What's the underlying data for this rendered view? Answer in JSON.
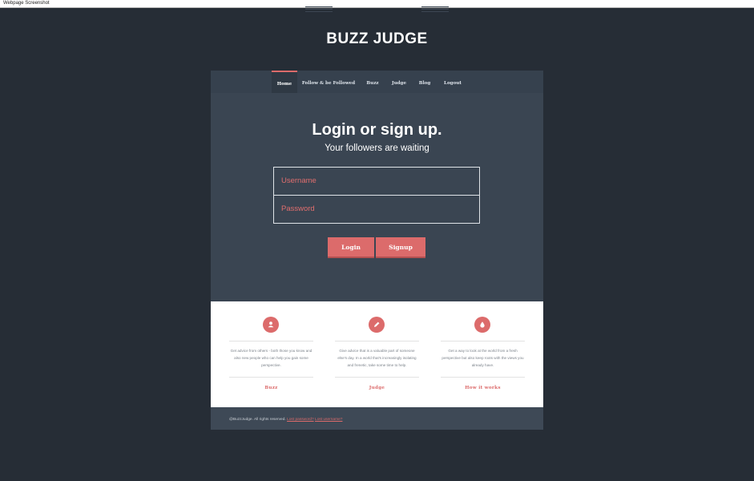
{
  "window": {
    "title": "Webpage Screenshot"
  },
  "site": {
    "logo": "BUZZ JUDGE"
  },
  "nav": {
    "items": [
      {
        "label": "Home",
        "active": true
      },
      {
        "label": "Follow & be Followed",
        "active": false
      },
      {
        "label": "Buzz",
        "active": false
      },
      {
        "label": "Judge",
        "active": false
      },
      {
        "label": "Blog",
        "active": false
      },
      {
        "label": "Logout",
        "active": false
      }
    ]
  },
  "hero": {
    "title": "Login or sign up.",
    "subtitle": "Your followers are waiting"
  },
  "form": {
    "username_placeholder": "Username",
    "password_placeholder": "Password",
    "login_label": "Login",
    "signup_label": "Signup"
  },
  "features": [
    {
      "icon": "user-icon",
      "text": "Get advice from others - both those you know and also new people who can help you gain some perspective.",
      "link": "Buzz"
    },
    {
      "icon": "pencil-icon",
      "text": "Give advice that is a valuable part of someone else's day. In a world that's increasingly isolating and frenetic, take some time to help.",
      "link": "Judge"
    },
    {
      "icon": "drop-icon",
      "text": "Get a way to look at the world from a fresh perspective but also keep roots with the views you already have.",
      "link": "How it works"
    }
  ],
  "footer": {
    "copyright": "@BuzzJudge. All rights reserved.",
    "lost_password": "Lost password?",
    "lost_username": "Lost username?"
  },
  "colors": {
    "page_bg": "#262d36",
    "card_bg": "#3a4552",
    "accent": "#dc6b6b",
    "features_bg": "#ffffff"
  }
}
